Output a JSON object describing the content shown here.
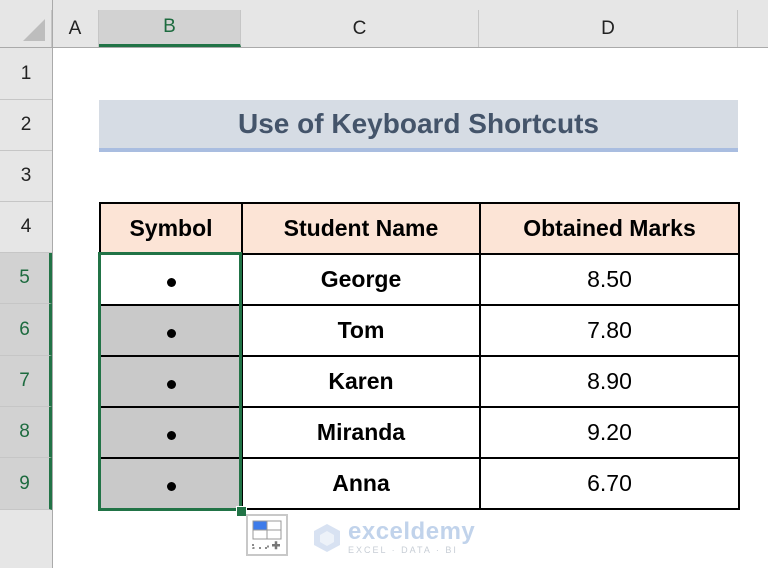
{
  "sheet": {
    "column_headers": [
      "A",
      "B",
      "C",
      "D"
    ],
    "selected_column": "B",
    "row_headers": [
      "1",
      "2",
      "3",
      "4",
      "5",
      "6",
      "7",
      "8",
      "9"
    ],
    "selected_rows": [
      "5",
      "6",
      "7",
      "8",
      "9"
    ]
  },
  "title": "Use of Keyboard Shortcuts",
  "table": {
    "headers": [
      "Symbol",
      "Student Name",
      "Obtained Marks"
    ],
    "rows": [
      {
        "symbol": "•",
        "name": "George",
        "marks": "8.50"
      },
      {
        "symbol": "•",
        "name": "Tom",
        "marks": "7.80"
      },
      {
        "symbol": "•",
        "name": "Karen",
        "marks": "8.90"
      },
      {
        "symbol": "•",
        "name": "Miranda",
        "marks": "9.20"
      },
      {
        "symbol": "•",
        "name": "Anna",
        "marks": "6.70"
      }
    ]
  },
  "colors": {
    "selection": "#217346",
    "header_fill": "#fce4d6",
    "title_fill": "#d6dce4",
    "title_text": "#44546a",
    "selected_fill": "#c9c9c9"
  },
  "quick_analysis": {
    "icon": "quick-analysis-icon"
  },
  "watermark": {
    "name": "exceldemy",
    "tagline": "EXCEL · DATA · BI"
  }
}
